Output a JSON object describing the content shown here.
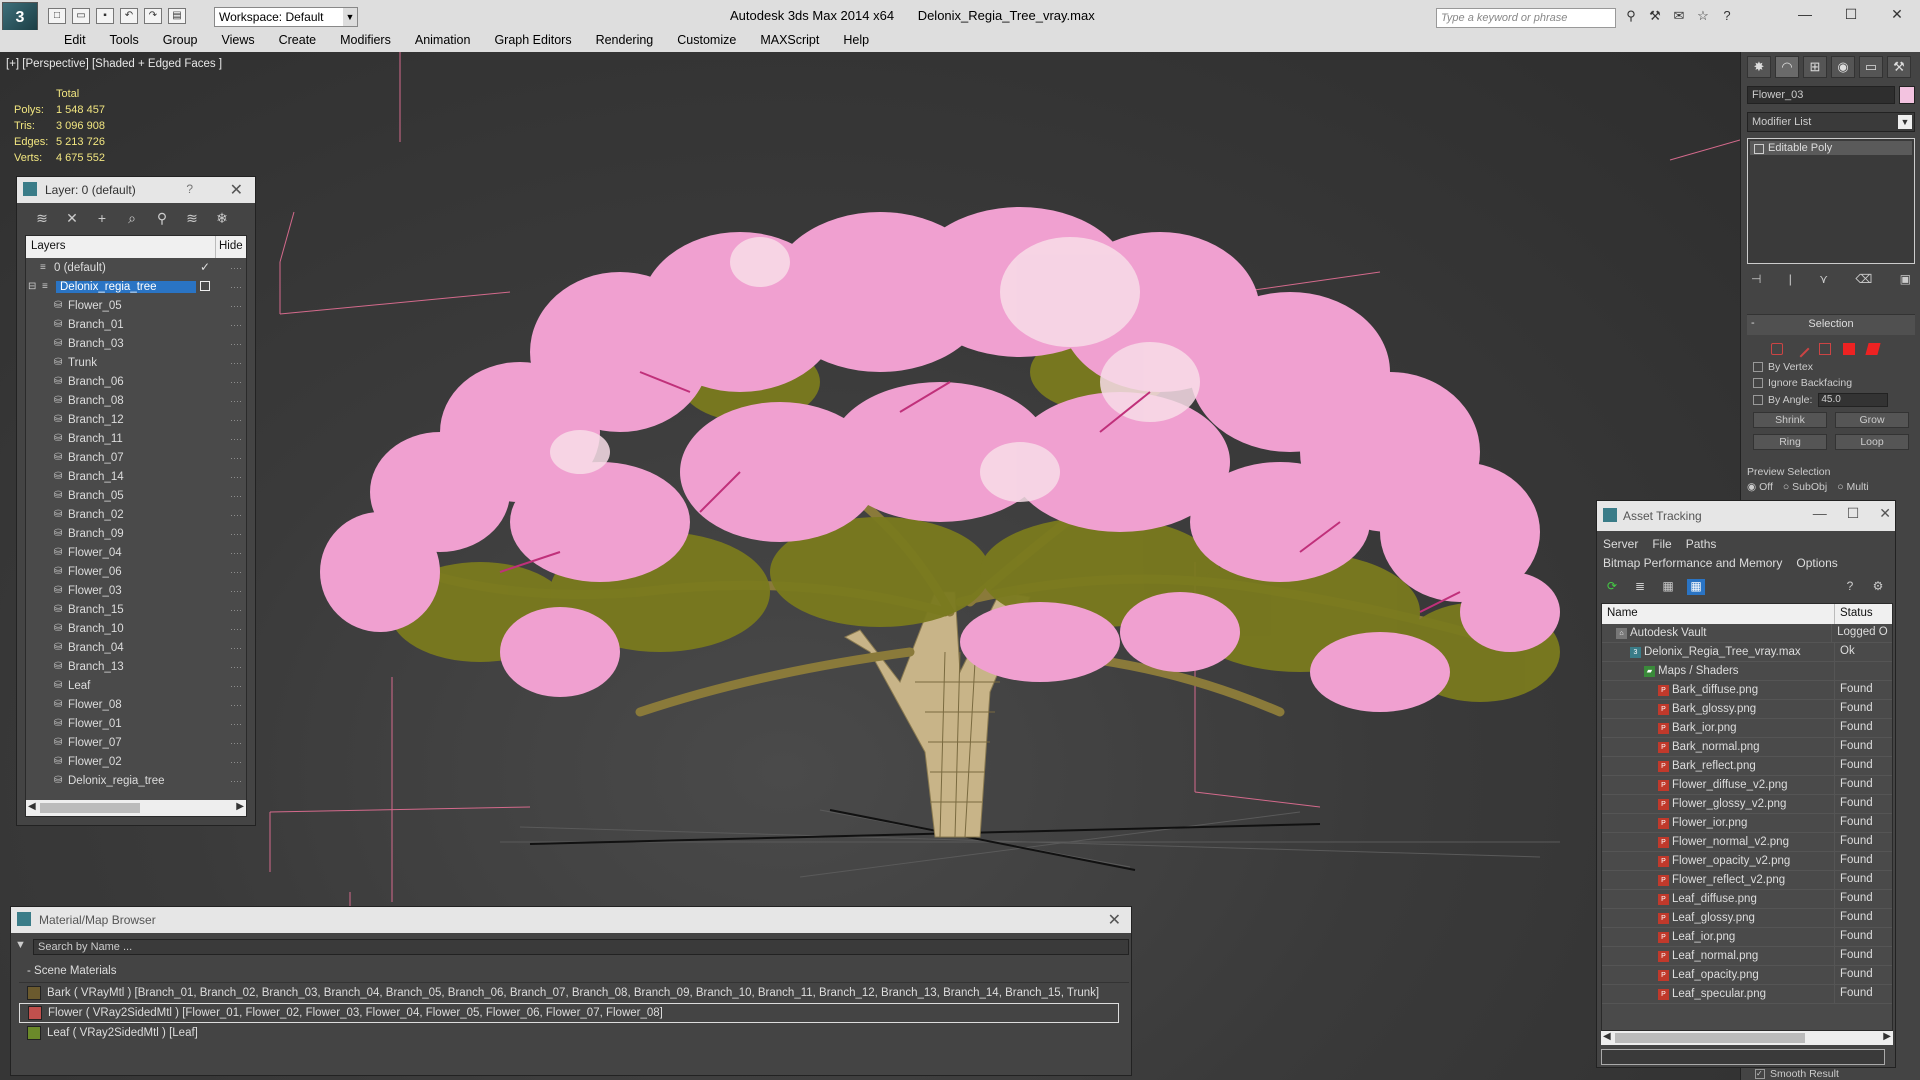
{
  "titlebar": {
    "workspace": "Workspace: Default",
    "app": "Autodesk 3ds Max  2014 x64",
    "file": "Delonix_Regia_Tree_vray.max",
    "search_placeholder": "Type a keyword or phrase"
  },
  "menu": [
    "Edit",
    "Tools",
    "Group",
    "Views",
    "Create",
    "Modifiers",
    "Animation",
    "Graph Editors",
    "Rendering",
    "Customize",
    "MAXScript",
    "Help"
  ],
  "viewport": {
    "label": "[+] [Perspective] [Shaded + Edged Faces ]",
    "stats": {
      "header": "Total",
      "rows": [
        {
          "k": "Polys:",
          "v": "1 548 457"
        },
        {
          "k": "Tris:",
          "v": "3 096 908"
        },
        {
          "k": "Edges:",
          "v": "5 213 726"
        },
        {
          "k": "Verts:",
          "v": "4 675 552"
        }
      ]
    }
  },
  "layer_panel": {
    "title": "Layer: 0 (default)",
    "help": "?",
    "col_layers": "Layers",
    "col_hide": "Hide",
    "default_layer": "0 (default)",
    "selected_layer": "Delonix_regia_tree",
    "objects": [
      "Flower_05",
      "Branch_01",
      "Branch_03",
      "Trunk",
      "Branch_06",
      "Branch_08",
      "Branch_12",
      "Branch_11",
      "Branch_07",
      "Branch_14",
      "Branch_05",
      "Branch_02",
      "Branch_09",
      "Flower_04",
      "Flower_06",
      "Flower_03",
      "Branch_15",
      "Branch_10",
      "Branch_04",
      "Branch_13",
      "Leaf",
      "Flower_08",
      "Flower_01",
      "Flower_07",
      "Flower_02",
      "Delonix_regia_tree"
    ]
  },
  "material_browser": {
    "title": "Material/Map Browser",
    "search_placeholder": "Search by Name ...",
    "section": "- Scene Materials",
    "materials": [
      {
        "text": "Bark  ( VRayMtl )  [Branch_01, Branch_02, Branch_03, Branch_04, Branch_05, Branch_06, Branch_07, Branch_08, Branch_09, Branch_10, Branch_11, Branch_12, Branch_13, Branch_14, Branch_15, Trunk]",
        "color": "#6b5a2e"
      },
      {
        "text": "Flower  ( VRay2SidedMtl )  [Flower_01, Flower_02, Flower_03, Flower_04, Flower_05, Flower_06, Flower_07, Flower_08]",
        "color": "#c0504d"
      },
      {
        "text": "Leaf  ( VRay2SidedMtl )  [Leaf]",
        "color": "#6b8a2a"
      }
    ]
  },
  "command_panel": {
    "object_name": "Flower_03",
    "modifier_list": "Modifier List",
    "stack_item": "Editable Poly",
    "selection_title": "Selection",
    "by_vertex": "By Vertex",
    "ignore_backfacing": "Ignore Backfacing",
    "by_angle": "By Angle:",
    "angle_value": "45.0",
    "shrink": "Shrink",
    "grow": "Grow",
    "ring": "Ring",
    "loop": "Loop",
    "preview_selection": "Preview Selection",
    "preview_opts": [
      "Off",
      "SubObj",
      "Multi"
    ],
    "smooth_result": "Smooth Result"
  },
  "asset_tracking": {
    "title": "Asset Tracking",
    "menu1": [
      "Server",
      "File",
      "Paths"
    ],
    "menu2": [
      "Bitmap Performance and Memory",
      "Options"
    ],
    "col_name": "Name",
    "col_status": "Status",
    "rows": [
      {
        "name": "Autodesk Vault",
        "status": "Logged O",
        "indent": 1,
        "type": "vault"
      },
      {
        "name": "Delonix_Regia_Tree_vray.max",
        "status": "Ok",
        "indent": 2,
        "type": "max"
      },
      {
        "name": "Maps / Shaders",
        "status": "",
        "indent": 3,
        "type": "folder"
      },
      {
        "name": "Bark_diffuse.png",
        "status": "Found",
        "indent": 4,
        "type": "png"
      },
      {
        "name": "Bark_glossy.png",
        "status": "Found",
        "indent": 4,
        "type": "png"
      },
      {
        "name": "Bark_ior.png",
        "status": "Found",
        "indent": 4,
        "type": "png"
      },
      {
        "name": "Bark_normal.png",
        "status": "Found",
        "indent": 4,
        "type": "png"
      },
      {
        "name": "Bark_reflect.png",
        "status": "Found",
        "indent": 4,
        "type": "png"
      },
      {
        "name": "Flower_diffuse_v2.png",
        "status": "Found",
        "indent": 4,
        "type": "png"
      },
      {
        "name": "Flower_glossy_v2.png",
        "status": "Found",
        "indent": 4,
        "type": "png"
      },
      {
        "name": "Flower_ior.png",
        "status": "Found",
        "indent": 4,
        "type": "png"
      },
      {
        "name": "Flower_normal_v2.png",
        "status": "Found",
        "indent": 4,
        "type": "png"
      },
      {
        "name": "Flower_opacity_v2.png",
        "status": "Found",
        "indent": 4,
        "type": "png"
      },
      {
        "name": "Flower_reflect_v2.png",
        "status": "Found",
        "indent": 4,
        "type": "png"
      },
      {
        "name": "Leaf_diffuse.png",
        "status": "Found",
        "indent": 4,
        "type": "png"
      },
      {
        "name": "Leaf_glossy.png",
        "status": "Found",
        "indent": 4,
        "type": "png"
      },
      {
        "name": "Leaf_ior.png",
        "status": "Found",
        "indent": 4,
        "type": "png"
      },
      {
        "name": "Leaf_normal.png",
        "status": "Found",
        "indent": 4,
        "type": "png"
      },
      {
        "name": "Leaf_opacity.png",
        "status": "Found",
        "indent": 4,
        "type": "png"
      },
      {
        "name": "Leaf_specular.png",
        "status": "Found",
        "indent": 4,
        "type": "png"
      }
    ]
  },
  "colors": {
    "selection_blue": "#2a74c4",
    "stats_yellow": "#f2e680",
    "flower_pink": "#f0a0d0",
    "leaf_olive": "#7a7a1e",
    "bark": "#a89860"
  }
}
